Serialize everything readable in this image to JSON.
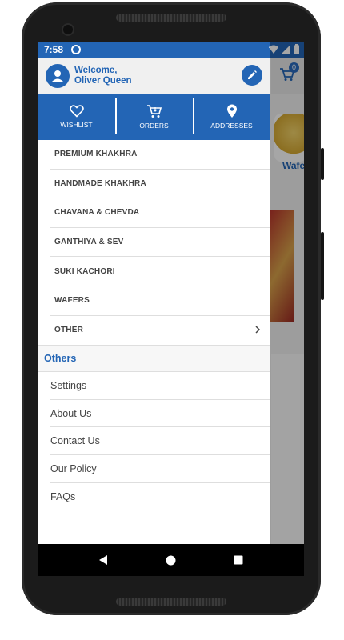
{
  "status_bar": {
    "time": "7:58"
  },
  "header": {
    "greeting": "Welcome,",
    "user_name": "Oliver Queen"
  },
  "quick_links": [
    {
      "label": "WISHLIST",
      "icon": "heart-icon"
    },
    {
      "label": "ORDERS",
      "icon": "cart-icon"
    },
    {
      "label": "ADDRESSES",
      "icon": "location-pin-icon"
    }
  ],
  "categories": [
    {
      "label": "PREMIUM KHAKHRA"
    },
    {
      "label": "HANDMADE KHAKHRA"
    },
    {
      "label": "CHAVANA & CHEVDA"
    },
    {
      "label": "GANTHIYA & SEV"
    },
    {
      "label": "SUKI KACHORI"
    },
    {
      "label": "WAFERS"
    },
    {
      "label": "OTHER"
    }
  ],
  "others": {
    "heading": "Others",
    "links": [
      {
        "label": "Settings"
      },
      {
        "label": "About Us"
      },
      {
        "label": "Contact Us"
      },
      {
        "label": "Our Policy"
      },
      {
        "label": "FAQs"
      }
    ]
  },
  "background_app": {
    "cart_count": "0",
    "visible_text": "Wafer"
  },
  "colors": {
    "primary": "#2365b5",
    "header_bg": "#f0f0f0",
    "text": "#444444"
  }
}
